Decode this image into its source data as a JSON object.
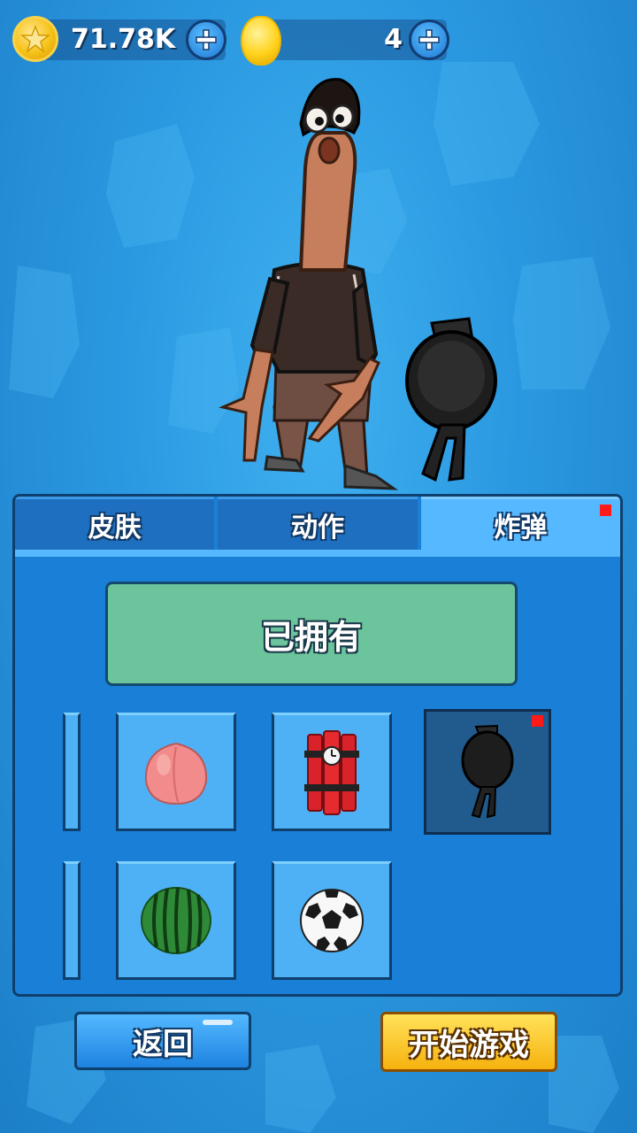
{
  "currency": {
    "gold_value": "71.78K",
    "gem_value": "4"
  },
  "tabs": [
    {
      "label": "皮肤",
      "active": false
    },
    {
      "label": "动作",
      "active": false
    },
    {
      "label": "炸弹",
      "active": true
    }
  ],
  "owned_label": "已拥有",
  "items": [
    {
      "icon": "peach-icon",
      "selected": false
    },
    {
      "icon": "dynamite-icon",
      "selected": false
    },
    {
      "icon": "frying-pan-icon",
      "selected": true
    },
    {
      "icon": "watermelon-icon",
      "selected": false
    },
    {
      "icon": "soccer-ball-icon",
      "selected": false
    }
  ],
  "buttons": {
    "back_label": "返回",
    "start_label": "开始游戏"
  },
  "colors": {
    "background": "#2a98e0",
    "panel": "#1a7fd6",
    "active_tab": "#56b8ff",
    "owned_button": "#6cc49c",
    "start_button": "#f6b20e",
    "notification_dot": "#ff1a1a"
  }
}
